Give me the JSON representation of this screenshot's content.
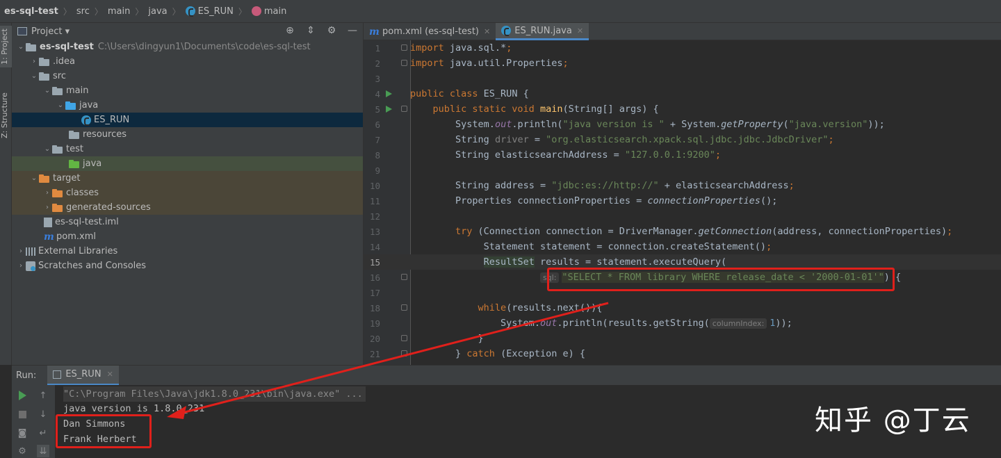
{
  "breadcrumb": {
    "items": [
      "es-sql-test",
      "src",
      "main",
      "java",
      "ES_RUN",
      "main"
    ]
  },
  "tool_strip": {
    "project_tab": "1: Project",
    "structure_tab": "Z: Structure"
  },
  "project_panel": {
    "title": "Project",
    "tree": [
      {
        "label": "es-sql-test",
        "path": "C:\\Users\\dingyun1\\Documents\\code\\es-sql-test",
        "icon": "folder-icon"
      },
      {
        "label": ".idea",
        "icon": "folder-icon"
      },
      {
        "label": "src",
        "icon": "folder-icon"
      },
      {
        "label": "main",
        "icon": "folder-icon"
      },
      {
        "label": "java",
        "icon": "source-folder-icon"
      },
      {
        "label": "ES_RUN",
        "icon": "java-class-icon"
      },
      {
        "label": "resources",
        "icon": "resources-folder-icon"
      },
      {
        "label": "test",
        "icon": "folder-icon"
      },
      {
        "label": "java",
        "icon": "test-folder-icon"
      },
      {
        "label": "target",
        "icon": "excluded-folder-icon"
      },
      {
        "label": "classes",
        "icon": "excluded-folder-icon"
      },
      {
        "label": "generated-sources",
        "icon": "excluded-folder-icon"
      },
      {
        "label": "es-sql-test.iml",
        "icon": "iml-file-icon"
      },
      {
        "label": "pom.xml",
        "icon": "maven-icon"
      },
      {
        "label": "External Libraries",
        "icon": "library-icon"
      },
      {
        "label": "Scratches and Consoles",
        "icon": "scratch-icon"
      }
    ]
  },
  "editor_tabs": [
    {
      "label": "pom.xml (es-sql-test)",
      "icon": "maven-icon",
      "active": false
    },
    {
      "label": "ES_RUN.java",
      "icon": "java-class-icon",
      "active": true
    }
  ],
  "editor": {
    "lines": [
      {
        "n": "1"
      },
      {
        "n": "2"
      },
      {
        "n": "3"
      },
      {
        "n": "4"
      },
      {
        "n": "5"
      },
      {
        "n": "6"
      },
      {
        "n": "7"
      },
      {
        "n": "8"
      },
      {
        "n": "9"
      },
      {
        "n": "10"
      },
      {
        "n": "11"
      },
      {
        "n": "12"
      },
      {
        "n": "13"
      },
      {
        "n": "14"
      },
      {
        "n": "15"
      },
      {
        "n": "16"
      },
      {
        "n": "17"
      },
      {
        "n": "18"
      },
      {
        "n": "19"
      },
      {
        "n": "20"
      },
      {
        "n": "21"
      }
    ],
    "code": {
      "l1_kw": "import",
      "l1_rest": " java.sql.*",
      "l2_kw": "import",
      "l2_rest": " java.util.Properties",
      "l4_kw": "public class",
      "l4_rest": " ES_RUN {",
      "l5_kw": "public static void",
      "l5_m": "main",
      "l5_rest": "(String[] args) {",
      "l6_a": "System.",
      "l6_f": "out",
      "l6_b": ".println(",
      "l6_s": "\"java version is \"",
      "l6_c": " + System.",
      "l6_m": "getProperty",
      "l6_d": "(",
      "l6_s2": "\"java.version\"",
      "l6_e": "));",
      "l7_a": "String ",
      "l7_v": "driver",
      "l7_b": " = ",
      "l7_s": "\"org.elasticsearch.xpack.sql.jdbc.jdbc.JdbcDriver\"",
      "l8_a": "String elasticsearchAddress = ",
      "l8_s": "\"127.0.0.1:9200\"",
      "l10_a": "String address = ",
      "l10_s": "\"jdbc:es://http://\"",
      "l10_b": " + elasticsearchAddress",
      "l11_a": "Properties connectionProperties = ",
      "l11_m": "connectionProperties",
      "l11_b": "();",
      "l13_kw": "try",
      "l13_a": " (Connection connection = DriverManager.",
      "l13_m": "getConnection",
      "l13_b": "(address, connectionProperties)",
      "l14_a": "Statement statement = connection.createStatement()",
      "l15_a": "ResultSet",
      "l15_b": " results = statement.executeQuery(",
      "l16_hint": "sql:",
      "l16_s": "\"SELECT * FROM library WHERE release_date < '2000-01-01'\"",
      "l16_b": ") {",
      "l18_kw": "while",
      "l18_a": "(results.next()){",
      "l19_a": "System.",
      "l19_f": "out",
      "l19_b": ".println(results.getString(",
      "l19_hint": "columnIndex:",
      "l19_n": "1",
      "l19_c": "));",
      "l20_a": "}",
      "l21_a": "} ",
      "l21_kw": "catch",
      "l21_b": " (Exception e) {"
    }
  },
  "run_panel": {
    "title": "Run:",
    "tab_label": "ES_RUN",
    "console": [
      "\"C:\\Program Files\\Java\\jdk1.8.0_231\\bin\\java.exe\" ...",
      "java version is 1.8.0_231",
      "Dan Simmons",
      "Frank Herbert"
    ]
  },
  "watermark": "知乎 @丁云",
  "colors": {
    "annotation_red": "#e0201b",
    "keyword": "#cc7832",
    "string": "#6a8759",
    "method": "#ffc66d",
    "field": "#9876aa"
  }
}
